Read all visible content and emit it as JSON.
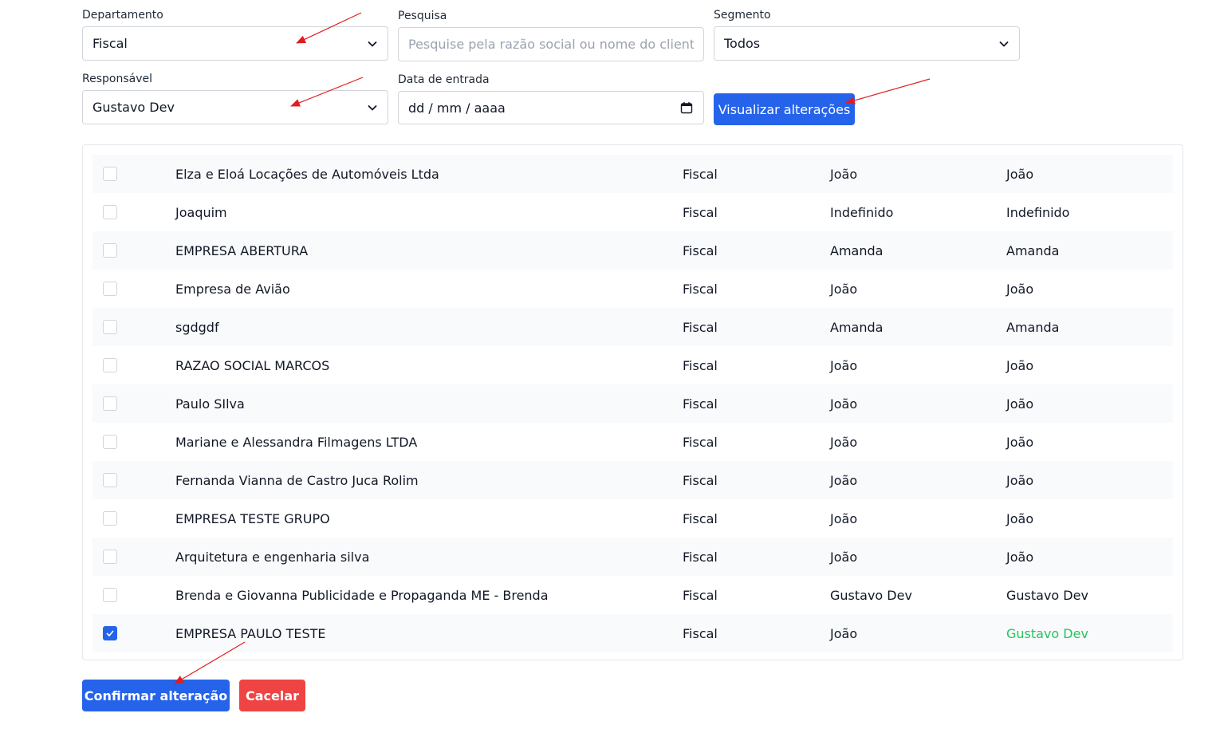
{
  "filters": {
    "departamento": {
      "label": "Departamento",
      "value": "Fiscal"
    },
    "pesquisa": {
      "label": "Pesquisa",
      "placeholder": "Pesquise pela razão social ou nome do cliente"
    },
    "segmento": {
      "label": "Segmento",
      "value": "Todos"
    },
    "responsavel": {
      "label": "Responsável",
      "value": "Gustavo Dev"
    },
    "data_entrada": {
      "label": "Data de entrada",
      "value": "dd / mm / aaaa"
    },
    "visualizar_label": "Visualizar alterações"
  },
  "rows": [
    {
      "checked": false,
      "name": "Elza e Eloá Locações de Automóveis Ltda",
      "dept": "Fiscal",
      "old": "João",
      "new": "João"
    },
    {
      "checked": false,
      "name": "Joaquim",
      "dept": "Fiscal",
      "old": "Indefinido",
      "new": "Indefinido"
    },
    {
      "checked": false,
      "name": "EMPRESA ABERTURA",
      "dept": "Fiscal",
      "old": "Amanda",
      "new": "Amanda"
    },
    {
      "checked": false,
      "name": "Empresa de Avião",
      "dept": "Fiscal",
      "old": "João",
      "new": "João"
    },
    {
      "checked": false,
      "name": "sgdgdf",
      "dept": "Fiscal",
      "old": "Amanda",
      "new": "Amanda"
    },
    {
      "checked": false,
      "name": "RAZAO SOCIAL MARCOS",
      "dept": "Fiscal",
      "old": "João",
      "new": "João"
    },
    {
      "checked": false,
      "name": "Paulo SIlva",
      "dept": "Fiscal",
      "old": "João",
      "new": "João"
    },
    {
      "checked": false,
      "name": "Mariane e Alessandra Filmagens LTDA",
      "dept": "Fiscal",
      "old": "João",
      "new": "João"
    },
    {
      "checked": false,
      "name": "Fernanda Vianna de Castro Juca Rolim",
      "dept": "Fiscal",
      "old": "João",
      "new": "João"
    },
    {
      "checked": false,
      "name": "EMPRESA TESTE GRUPO",
      "dept": "Fiscal",
      "old": "João",
      "new": "João"
    },
    {
      "checked": false,
      "name": "Arquitetura e engenharia silva",
      "dept": "Fiscal",
      "old": "João",
      "new": "João"
    },
    {
      "checked": false,
      "name": "Brenda e Giovanna Publicidade e Propaganda ME - Brenda",
      "dept": "Fiscal",
      "old": "Gustavo Dev",
      "new": "Gustavo Dev"
    },
    {
      "checked": true,
      "name": "EMPRESA PAULO TESTE",
      "dept": "Fiscal",
      "old": "João",
      "new": "Gustavo Dev"
    }
  ],
  "actions": {
    "confirm_label": "Confirmar alteração",
    "cancel_label": "Cacelar"
  },
  "colors": {
    "primary": "#2563eb",
    "danger": "#ef4444",
    "changed_text": "#22c55e",
    "annotation_arrow": "#e11d1d"
  },
  "icons": {
    "select_indicator": "chevron-down-icon",
    "date_picker": "calendar-icon",
    "checkbox_checked": "check-icon"
  }
}
